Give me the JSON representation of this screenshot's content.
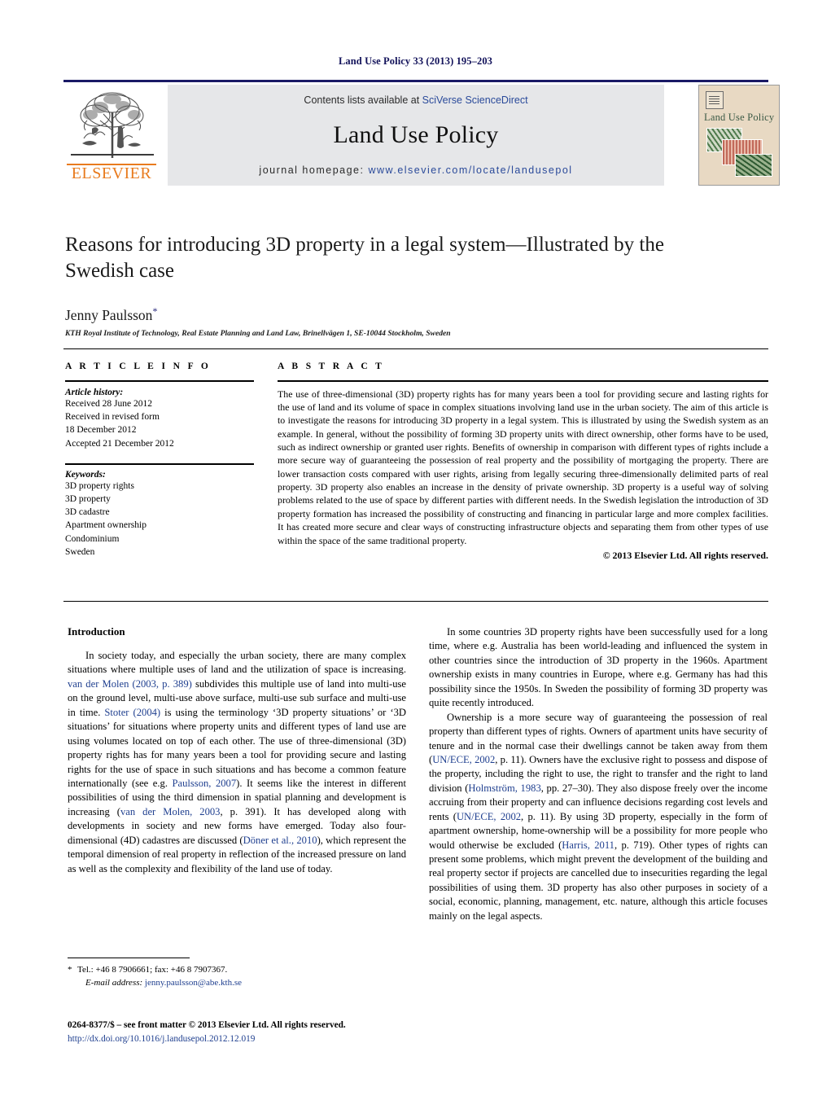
{
  "running_head": "Land Use Policy 33 (2013) 195–203",
  "masthead": {
    "contents_prefix": "Contents lists available at ",
    "sciencedirect": "SciVerse ScienceDirect",
    "journal_name": "Land Use Policy",
    "homepage_prefix": "journal homepage: ",
    "homepage_url": "www.elsevier.com/locate/landusepol",
    "publisher_wordmark": "ELSEVIER",
    "accent_blue": "#2a4a9a",
    "publisher_orange": "#e87b1e"
  },
  "cover": {
    "title": "Land Use Policy",
    "background": "#e8d9c3"
  },
  "article": {
    "title": "Reasons for introducing 3D property in a legal system—Illustrated by the Swedish case",
    "author": "Jenny Paulsson",
    "author_marker": "*",
    "affiliation": "KTH Royal Institute of Technology, Real Estate Planning and Land Law, Brinellvägen 1, SE-10044 Stockholm, Sweden"
  },
  "info": {
    "heading": "A R T I C L E   I N F O",
    "history_label": "Article history:",
    "history": [
      "Received 28 June 2012",
      "Received in revised form",
      "18 December 2012",
      "Accepted 21 December 2012"
    ],
    "keywords_label": "Keywords:",
    "keywords": [
      "3D property rights",
      "3D property",
      "3D cadastre",
      "Apartment ownership",
      "Condominium",
      "Sweden"
    ]
  },
  "abstract": {
    "heading": "A B S T R A C T",
    "text": "The use of three-dimensional (3D) property rights has for many years been a tool for providing secure and lasting rights for the use of land and its volume of space in complex situations involving land use in the urban society. The aim of this article is to investigate the reasons for introducing 3D property in a legal system. This is illustrated by using the Swedish system as an example. In general, without the possibility of forming 3D property units with direct ownership, other forms have to be used, such as indirect ownership or granted user rights. Benefits of ownership in comparison with different types of rights include a more secure way of guaranteeing the possession of real property and the possibility of mortgaging the property. There are lower transaction costs compared with user rights, arising from legally securing three-dimensionally delimited parts of real property. 3D property also enables an increase in the density of private ownership. 3D property is a useful way of solving problems related to the use of space by different parties with different needs. In the Swedish legislation the introduction of 3D property formation has increased the possibility of constructing and financing in particular large and more complex facilities. It has created more secure and clear ways of constructing infrastructure objects and separating them from other types of use within the space of the same traditional property.",
    "copyright": "© 2013 Elsevier Ltd. All rights reserved."
  },
  "body": {
    "section_heading": "Introduction",
    "left_paragraph_1_a": "In society today, and especially the urban society, there are many complex situations where multiple uses of land and the utilization of space is increasing. ",
    "left_cite_1": "van der Molen (2003, p. 389)",
    "left_paragraph_1_b": " subdivides this multiple use of land into multi-use on the ground level, multi-use above surface, multi-use sub surface and multi-use in time. ",
    "left_cite_2": "Stoter (2004)",
    "left_paragraph_1_c": " is using the terminology ‘3D property situations’ or ‘3D situations’ for situations where property units and different types of land use are using volumes located on top of each other. The use of three-dimensional (3D) property rights has for many years been a tool for providing secure and lasting rights for the use of space in such situations and has become a common feature internationally (see e.g. ",
    "left_cite_3": "Paulsson, 2007",
    "left_paragraph_1_d": "). It seems like the interest in different possibilities of using the third dimension in spatial planning and development is increasing (",
    "left_cite_4": "van der Molen, 2003",
    "left_paragraph_1_e": ", p. 391). It has developed along with developments in society and new forms have emerged. Today also four-dimensional (4D) cadastres are discussed (",
    "left_cite_5": "Döner et al., 2010",
    "left_paragraph_1_f": "), which represent the temporal dimension of real property in reflection of the increased pressure on land as well as the complexity and flexibility of the land use of today.",
    "right_paragraph_1": "In some countries 3D property rights have been successfully used for a long time, where e.g. Australia has been world-leading and influenced the system in other countries since the introduction of 3D property in the 1960s. Apartment ownership exists in many countries in Europe, where e.g. Germany has had this possibility since the 1950s. In Sweden the possibility of forming 3D property was quite recently introduced.",
    "right_paragraph_2_a": "Ownership is a more secure way of guaranteeing the possession of real property than different types of rights. Owners of apartment units have security of tenure and in the normal case their dwellings cannot be taken away from them (",
    "right_cite_1": "UN/ECE, 2002",
    "right_paragraph_2_b": ", p. 11). Owners have the exclusive right to possess and dispose of the property, including the right to use, the right to transfer and the right to land division (",
    "right_cite_2": "Holmström, 1983",
    "right_paragraph_2_c": ", pp. 27–30). They also dispose freely over the income accruing from their property and can influence decisions regarding cost levels and rents (",
    "right_cite_3": "UN/ECE, 2002",
    "right_paragraph_2_d": ", p. 11). By using 3D property, especially in the form of apartment ownership, home-ownership will be a possibility for more people who would otherwise be excluded (",
    "right_cite_4": "Harris, 2011",
    "right_paragraph_2_e": ", p. 719). Other types of rights can present some problems, which might prevent the development of the building and real property sector if projects are cancelled due to insecurities regarding the legal possibilities of using them. 3D property has also other purposes in society of a social, economic, planning, management, etc. nature, although this article focuses mainly on the legal aspects."
  },
  "footnotes": {
    "tel": "Tel.: +46 8 7906661; fax: +46 8 7907367.",
    "email_label": "E-mail address:",
    "email": "jenny.paulsson@abe.kth.se",
    "frontmatter": "0264-8377/$ – see front matter © 2013 Elsevier Ltd. All rights reserved.",
    "doi": "http://dx.doi.org/10.1016/j.landusepol.2012.12.019"
  }
}
